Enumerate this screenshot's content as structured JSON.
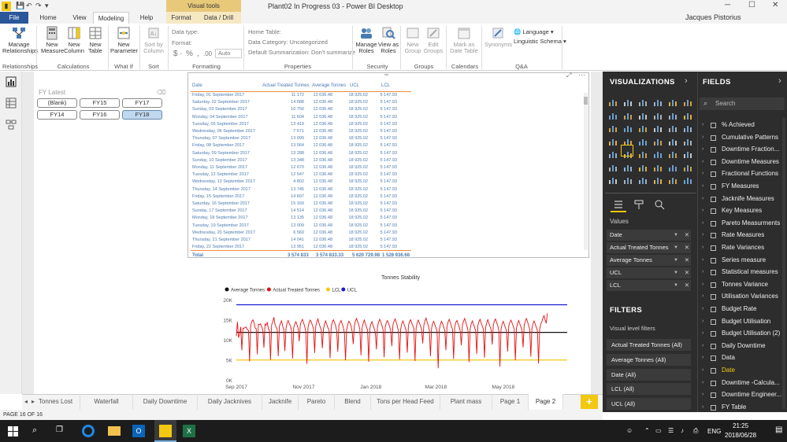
{
  "titlebar": {
    "window_title": "Plant02 In Progress 03 - Power BI Desktop",
    "visual_tools": "Visual tools",
    "user": "Jacques Pistorius"
  },
  "tabs": {
    "file": "File",
    "home": "Home",
    "view": "View",
    "modeling": "Modeling",
    "help": "Help",
    "format": "Format",
    "data_drill": "Data / Drill"
  },
  "ribbon": {
    "manage_relationships": "Manage\nRelationships",
    "new_measure": "New\nMeasure",
    "new_column": "New\nColumn",
    "new_table": "New\nTable",
    "new_parameter": "New\nParameter",
    "sort_by_column": "Sort by\nColumn",
    "data_type": "Data type:",
    "format": "Format:",
    "auto": "Auto",
    "home_table": "Home Table:",
    "data_category": "Data Category: Uncategorized",
    "default_summarization": "Default Summarization: Don't summarize",
    "manage_roles": "Manage\nRoles",
    "view_as_roles": "View as\nRoles",
    "new_group": "New\nGroup",
    "edit_groups": "Edit\nGroups",
    "mark_as_date_table": "Mark as\nDate Table",
    "synonyms": "Synonyms",
    "language": "Language",
    "linguistic_schema": "Linguistic Schema",
    "groups": {
      "relationships": "Relationships",
      "calculations": "Calculations",
      "what_if": "What If",
      "sort": "Sort",
      "formatting": "Formatting",
      "properties": "Properties",
      "security": "Security",
      "groups": "Groups",
      "calendars": "Calendars",
      "qa": "Q&A"
    }
  },
  "slicer": {
    "title": "FY Latest",
    "items": [
      "(Blank)",
      "FY15",
      "FY17",
      "FY14",
      "FY16",
      "FY18"
    ],
    "selected": "FY18"
  },
  "table": {
    "headers": [
      "Date",
      "Actual Treated Tonnes",
      "Average Tonnes",
      "UCL",
      "LCL"
    ],
    "rows": [
      [
        "Friday, 01 September 2017",
        "11 172",
        "12 036.48",
        "18 925.02",
        "5 147.93"
      ],
      [
        "Saturday, 02 September 2017",
        "14 688",
        "12 036.48",
        "18 925.02",
        "5 147.93"
      ],
      [
        "Sunday, 03 September 2017",
        "10 750",
        "12 036.48",
        "18 925.02",
        "5 147.93"
      ],
      [
        "Monday, 04 September 2017",
        "11 604",
        "12 036.48",
        "18 925.02",
        "5 147.93"
      ],
      [
        "Tuesday, 05 September 2017",
        "13 419",
        "12 036.48",
        "18 925.02",
        "5 147.93"
      ],
      [
        "Wednesday, 06 September 2017",
        "7 571",
        "12 036.48",
        "18 925.02",
        "5 147.93"
      ],
      [
        "Thursday, 07 September 2017",
        "13 099",
        "12 036.48",
        "18 925.02",
        "5 147.93"
      ],
      [
        "Friday, 08 September 2017",
        "13 064",
        "12 036.48",
        "18 925.02",
        "5 147.93"
      ],
      [
        "Saturday, 09 September 2017",
        "13 288",
        "12 036.48",
        "18 925.02",
        "5 147.93"
      ],
      [
        "Sunday, 10 September 2017",
        "13 348",
        "12 036.48",
        "18 925.02",
        "5 147.93"
      ],
      [
        "Monday, 11 September 2017",
        "12 670",
        "12 036.48",
        "18 925.02",
        "5 147.93"
      ],
      [
        "Tuesday, 12 September 2017",
        "12 547",
        "12 036.48",
        "18 925.02",
        "5 147.93"
      ],
      [
        "Wednesday, 13 September 2017",
        "4 802",
        "12 036.48",
        "18 925.02",
        "5 147.93"
      ],
      [
        "Thursday, 14 September 2017",
        "13 745",
        "12 036.48",
        "18 925.02",
        "5 147.93"
      ],
      [
        "Friday, 15 September 2017",
        "14 697",
        "12 036.48",
        "18 925.02",
        "5 147.93"
      ],
      [
        "Saturday, 16 September 2017",
        "15 169",
        "12 036.48",
        "18 925.02",
        "5 147.93"
      ],
      [
        "Sunday, 17 September 2017",
        "14 514",
        "12 036.48",
        "18 925.02",
        "5 147.93"
      ],
      [
        "Monday, 18 September 2017",
        "13 135",
        "12 036.48",
        "18 925.02",
        "5 147.93"
      ],
      [
        "Tuesday, 19 September 2017",
        "13 009",
        "12 036.48",
        "18 925.02",
        "5 147.93"
      ],
      [
        "Wednesday, 20 September 2017",
        "6 560",
        "12 036.48",
        "18 925.02",
        "5 147.93"
      ],
      [
        "Thursday, 21 September 2017",
        "14 041",
        "12 036.48",
        "18 925.02",
        "5 147.93"
      ],
      [
        "Friday, 22 September 2017",
        "13 951",
        "12 036.48",
        "18 925.02",
        "5 147.93"
      ]
    ],
    "total": [
      "Total",
      "3 574 833",
      "3 574 833.33",
      "5 620 729.98",
      "1 528 936.68"
    ]
  },
  "chart_data": {
    "type": "line",
    "title": "Tonnes Stability",
    "legend": [
      "Average Tonnes",
      "Actual Treated Tonnes",
      "LCL",
      "UCL"
    ],
    "legend_colors": [
      "#111111",
      "#e81010",
      "#f2c811",
      "#1a1ad0"
    ],
    "legend_position": "top-left",
    "x_ticks": [
      "Sep 2017",
      "Nov 2017",
      "Jan 2018",
      "Mar 2018",
      "May 2018"
    ],
    "y_ticks": [
      "0K",
      "5K",
      "10K",
      "15K",
      "20K"
    ],
    "ylim": [
      0,
      20000
    ],
    "xlim": [
      "2017-09-01",
      "2018-06-28"
    ],
    "series": [
      {
        "name": "Average Tonnes",
        "value": 12036.48
      },
      {
        "name": "UCL",
        "value": 18925.02
      },
      {
        "name": "LCL",
        "value": 5147.93
      },
      {
        "name": "Actual Treated Tonnes",
        "x_start": "2017-09-01",
        "values": [
          11172,
          14688,
          10750,
          11604,
          13419,
          7571,
          13099,
          13064,
          13288,
          13348,
          12670,
          12547,
          4802,
          13745,
          14697,
          15169,
          14514,
          13135,
          13009,
          6560,
          14041,
          13951,
          14200,
          13400,
          12600,
          8200,
          14100,
          13800,
          14500,
          13000,
          12400,
          5200,
          13900,
          14600,
          15800,
          14100,
          13300,
          12900,
          6100,
          13500,
          14300,
          14900,
          13600,
          12800,
          7400,
          13000,
          14400,
          15000,
          14200,
          13700,
          12500,
          5500,
          13200,
          14100,
          14700,
          13900,
          13100,
          9800,
          14000,
          14800,
          15300,
          14400,
          13500,
          12200,
          4200,
          13300,
          14500,
          15100,
          14600,
          13800,
          12900,
          6900,
          13600,
          14700,
          15400,
          14300,
          13400,
          12600,
          8100,
          12800,
          14200,
          14900,
          14000,
          13200,
          12700,
          5600,
          13400,
          14600,
          15200,
          14500,
          13700,
          12400,
          7200,
          13800,
          14400,
          15000,
          14100,
          13300,
          11900,
          5100,
          12600,
          14000,
          14800,
          14400,
          13600,
          12300,
          9100,
          13700,
          14900,
          15500,
          14700,
          13900,
          12800,
          6300,
          13100,
          14300,
          15100,
          14200,
          13400,
          12600,
          4700,
          12900,
          14100,
          14700,
          13800,
          13000,
          12100,
          7800,
          13500,
          14600,
          15300,
          14600,
          13800,
          12700,
          5800,
          13300,
          14500,
          15000,
          14300,
          13500,
          12400,
          8600,
          13900,
          14800,
          15400,
          14500,
          13600,
          12300,
          5300,
          12800,
          14200,
          14900,
          14100,
          13300,
          12500,
          7000,
          13600,
          14700,
          15200,
          14400,
          13700,
          12900,
          4900,
          13200,
          14400,
          15100,
          14400,
          13600,
          12700,
          9300,
          13800,
          14900,
          15600,
          14600,
          13800,
          12600,
          6100,
          13000,
          14300,
          14800,
          13900,
          13200,
          12300,
          3100,
          12700,
          14000,
          14800,
          14200,
          13400,
          12500,
          7600,
          13500,
          14600,
          15300,
          14500,
          13600,
          12800,
          5400,
          13300,
          14500,
          15000,
          14200,
          13500,
          12400,
          8800,
          13900,
          14800,
          15500,
          14600,
          13700,
          12600,
          4600,
          12900,
          14200,
          14900,
          14100,
          13300,
          12400,
          6700,
          13700,
          14700,
          15300,
          14400,
          13600,
          12800,
          5700,
          13200,
          14400,
          15200,
          14300,
          13500,
          12700,
          9000,
          13800,
          14900,
          15400,
          14500,
          13700,
          12500,
          3500,
          12800,
          14100,
          14800,
          14000,
          13200,
          12300,
          7300,
          13600,
          14600,
          15100,
          14400,
          13600,
          12900,
          5100,
          13100,
          14300,
          15000,
          14200,
          13400,
          12600,
          8300,
          13900,
          14800,
          15500,
          14700,
          13800,
          12700,
          6000,
          13000,
          14200,
          14900,
          14100,
          13300,
          12400,
          4300,
          12800,
          14100,
          14700,
          15600,
          16200,
          15100,
          14300,
          16800
        ]
      }
    ]
  },
  "visualizations_pane": {
    "title": "VISUALIZATIONS",
    "values_label": "Values",
    "wells": [
      "Date",
      "Actual Treated Tonnes",
      "Average Tonnes",
      "UCL",
      "LCL"
    ],
    "filters_title": "FILTERS",
    "visual_level_filters": "Visual level filters",
    "filters": [
      "Actual Treated Tonnes (All)",
      "Average Tonnes (All)",
      "Date (All)",
      "LCL (All)",
      "UCL (All)"
    ]
  },
  "fields_pane": {
    "title": "FIELDS",
    "search_placeholder": "Search",
    "items": [
      "% Achieved",
      "Cumulative Patterns",
      "Downtime Fraction...",
      "Downtime Measures",
      "Fractional Functions",
      "FY Measures",
      "Jacknife Measures",
      "Key Measures",
      "Pareto Measurments",
      "Rate Measures",
      "Rate Variances",
      "Series measure",
      "Statistical measures",
      "Tonnes Variance",
      "Utilisation Variances",
      "Budget Rate",
      "Budget Utilisation",
      "Budget Utilisation (2)",
      "Daily Downtime",
      "Data",
      "Date",
      "Downtime -Calcula...",
      "Downtime Engineer...",
      "FY Table"
    ],
    "highlighted": "Date"
  },
  "page_tabs": [
    "Tonnes Lost",
    "Waterfall",
    "Daily Downtime",
    "Daily Jacknives",
    "Jacknife",
    "Pareto",
    "Blend",
    "Tons per Head Feed",
    "Plant mass",
    "Page 1",
    "Page 2"
  ],
  "active_page": "Page 2",
  "add_page": "+",
  "status": "PAGE 16 OF 16",
  "taskbar": {
    "lang": "ENG",
    "time": "21:25",
    "date": "2018/06/28"
  },
  "colors": {
    "accent": "#f2c811",
    "file_tab": "#2b579a",
    "pane_bg": "#2d2d2d"
  }
}
